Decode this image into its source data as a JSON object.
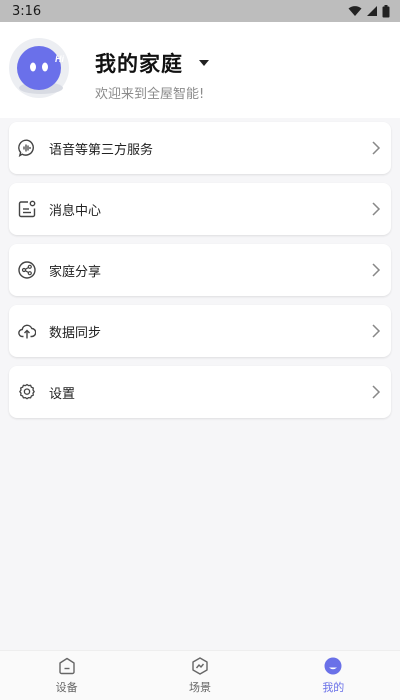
{
  "status_bar": {
    "time": "3:16"
  },
  "header": {
    "title": "我的家庭",
    "subtitle": "欢迎来到全屋智能!",
    "avatar_color": "#6a70ea"
  },
  "menu": [
    {
      "label": "语音等第三方服务",
      "icon": "voice-service-icon"
    },
    {
      "label": "消息中心",
      "icon": "message-icon"
    },
    {
      "label": "家庭分享",
      "icon": "share-icon"
    },
    {
      "label": "数据同步",
      "icon": "cloud-upload-icon"
    },
    {
      "label": "设置",
      "icon": "settings-gear-icon"
    }
  ],
  "bottom_nav": [
    {
      "label": "设备",
      "icon": "home-icon",
      "active": false
    },
    {
      "label": "场景",
      "icon": "scene-icon",
      "active": false
    },
    {
      "label": "我的",
      "icon": "profile-icon",
      "active": true
    }
  ],
  "colors": {
    "accent": "#6a71e8",
    "status_bar": "#bdbdbd"
  }
}
